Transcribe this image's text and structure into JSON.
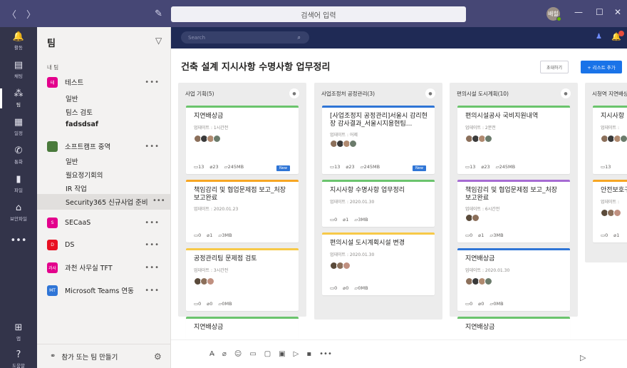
{
  "titlebar": {
    "search_placeholder": "검색어 입력",
    "avatar_initials": "배힐",
    "nav_back": "〈",
    "nav_fwd": "〉",
    "compose_icon": "pencil-square-icon",
    "minimize": "—",
    "maximize": "☐",
    "close": "✕"
  },
  "rail": {
    "items": [
      {
        "label": "활동",
        "icon": "bell-icon",
        "glyph": "🔔"
      },
      {
        "label": "채팅",
        "icon": "chat-icon",
        "glyph": "▤"
      },
      {
        "label": "팀",
        "icon": "teams-icon",
        "glyph": "⁂"
      },
      {
        "label": "일정",
        "icon": "calendar-icon",
        "glyph": "▦"
      },
      {
        "label": "통화",
        "icon": "phone-icon",
        "glyph": "✆"
      },
      {
        "label": "파일",
        "icon": "file-icon",
        "glyph": "▮"
      },
      {
        "label": "보안파일",
        "icon": "lock-icon",
        "glyph": "⌂"
      },
      {
        "label": "",
        "icon": "more-icon",
        "glyph": "•••"
      },
      {
        "label": "앱",
        "icon": "apps-icon",
        "glyph": "⊞"
      },
      {
        "label": "도움말",
        "icon": "help-icon",
        "glyph": "?"
      }
    ]
  },
  "panel": {
    "title": "팀",
    "my_teams_label": "내 팀",
    "teams": [
      {
        "badge": "테",
        "name": "테스트",
        "color": "#e3008c"
      },
      {
        "badge": "",
        "name": "소프트캠프 중역",
        "color": "#4a7a3c"
      },
      {
        "badge": "S",
        "name": "SECaaS",
        "color": "#e3008c"
      },
      {
        "badge": "D",
        "name": "DS",
        "color": "#e81123"
      },
      {
        "badge": "과사",
        "name": "과천 사무실 TFT",
        "color": "#e3008c"
      },
      {
        "badge": "MT",
        "name": "Microsoft Teams 연동",
        "color": "#2f75d6"
      }
    ],
    "channels_test": [
      "일반",
      "팀스 검토",
      "fadsdsaf"
    ],
    "channels_softcamp": [
      "일반",
      "월요정기회의",
      "IR 작업",
      "Security365 신규사업 준비"
    ],
    "more": "•••",
    "footer_label": "참가 또는 팀 만들기"
  },
  "board": {
    "search_placeholder": "Search",
    "title": "건축 설계 지시사항 수명사항 업무정리",
    "invite_label": "초대하기",
    "addlist_label": "+ 리스트 추가",
    "columns": [
      {
        "header": "사업 기획(5)",
        "cards": [
          {
            "title": "지연배상금",
            "updated": "업데이트 : 1시간전",
            "comments": "13",
            "links": "23",
            "files": "245MB",
            "new": "New",
            "bar": "#6bc46d",
            "avatars": [
              "#8b6f5a",
              "#3a3a3a",
              "#b08a70",
              "#6b7b6b"
            ]
          },
          {
            "title": "책임감리 및 협업문제점 보고_처장 보고완료",
            "updated": "업데이트 : 2020.01.23",
            "comments": "0",
            "links": "1",
            "files": "3MB",
            "new": "",
            "bar": "#f7a623",
            "avatars": []
          },
          {
            "title": "공정관리팀 문제점 검토",
            "updated": "업데이트 : 3시간전",
            "comments": "0",
            "links": "0",
            "files": "0MB",
            "new": "",
            "bar": "#f7c948",
            "avatars": [
              "#5a4a3a",
              "#8b6f5a",
              "#c09080"
            ]
          },
          {
            "title": "지연배상금",
            "updated": "",
            "comments": "",
            "links": "",
            "files": "",
            "new": "",
            "bar": "#6bc46d",
            "avatars": []
          }
        ]
      },
      {
        "header": "사업조정처 공정관리(3)",
        "cards": [
          {
            "title": "[사업조정지 공정관리]서울시 감리현장 감사결과_서울시지용현팀...",
            "updated": "업데이트 : 어제",
            "comments": "13",
            "links": "23",
            "files": "245MB",
            "new": "New",
            "bar": "#2f75d6",
            "avatars": [
              "#8b6f5a",
              "#3a3a3a",
              "#b08a70",
              "#6b7b6b"
            ]
          },
          {
            "title": "지시사항 수명사항 업무정리",
            "updated": "업데이트 : 2020.01.30",
            "comments": "0",
            "links": "1",
            "files": "3MB",
            "new": "",
            "bar": "#6bc46d",
            "avatars": []
          },
          {
            "title": "편의시설 도시계획시설 변경",
            "updated": "업데이트 : 2020.01.30",
            "comments": "0",
            "links": "0",
            "files": "0MB",
            "new": "",
            "bar": "#f7c948",
            "avatars": [
              "#5a4a3a",
              "#8b6f5a",
              "#c09080"
            ]
          }
        ]
      },
      {
        "header": "편의시설 도시계획(10)",
        "cards": [
          {
            "title": "편의시설공사 국비지원내역",
            "updated": "업데이트 : 2분전",
            "comments": "13",
            "links": "23",
            "files": "245MB",
            "new": "",
            "bar": "#6bc46d",
            "avatars": [
              "#8b6f5a",
              "#3a3a3a",
              "#b08a70",
              "#6b7b6b"
            ]
          },
          {
            "title": "책임감리 및 협업문제점 보고_처장 보고완료",
            "updated": "업데이트 : 6시간전",
            "comments": "0",
            "links": "1",
            "files": "3MB",
            "new": "",
            "bar": "#a66bd3",
            "avatars": [
              "#5a4a3a",
              "#8b6f5a"
            ]
          },
          {
            "title": "지연배상금",
            "updated": "업데이트 : 2020.01.30",
            "comments": "0",
            "links": "0",
            "files": "0MB",
            "new": "",
            "bar": "#2f75d6",
            "avatars": [
              "#8b6f5a",
              "#3a3a3a",
              "#b08a70",
              "#6b7b6b"
            ]
          },
          {
            "title": "지연배상금",
            "updated": "",
            "comments": "",
            "links": "",
            "files": "",
            "new": "",
            "bar": "#6bc46d",
            "avatars": []
          }
        ]
      },
      {
        "header": "시청역 지연배상",
        "cards": [
          {
            "title": "지시사항 ",
            "updated": "업데이트 : ",
            "comments": "13",
            "links": "",
            "files": "",
            "new": "",
            "bar": "#6bc46d",
            "avatars": [
              "#8b6f5a",
              "#3a3a3a",
              "#b08a70",
              "#6b7b6b"
            ]
          },
          {
            "title": "안전보호구",
            "updated": "업데이트 : ",
            "comments": "0",
            "links": "1",
            "files": "",
            "new": "",
            "bar": "#f7a623",
            "avatars": [
              "#5a4a3a",
              "#8b6f5a",
              "#c09080"
            ]
          }
        ]
      }
    ]
  },
  "compose": {
    "icons": [
      "format-icon",
      "attach-icon",
      "emoji-icon",
      "gif-icon",
      "sticker-icon",
      "meet-icon",
      "stream-icon",
      "app-icon",
      "more-icon"
    ],
    "glyphs": [
      "A̶",
      "⌀",
      "☺",
      "▭",
      "▢",
      "▣",
      "▷",
      "▪",
      "•••"
    ]
  }
}
